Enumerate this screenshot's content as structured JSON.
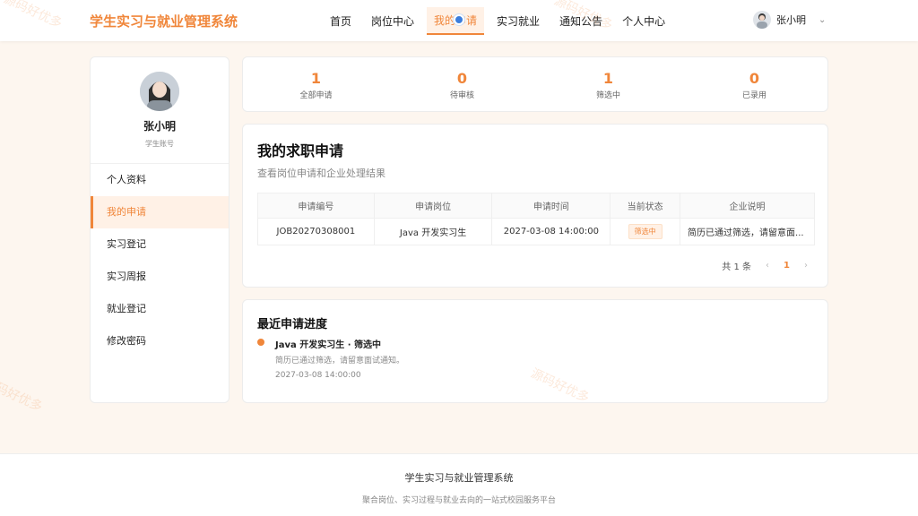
{
  "header": {
    "brand": "学生实习与就业管理系统",
    "nav": [
      {
        "label": "首页"
      },
      {
        "label": "岗位中心"
      },
      {
        "label": "我的申请"
      },
      {
        "label": "实习就业"
      },
      {
        "label": "通知公告"
      },
      {
        "label": "个人中心"
      }
    ],
    "active_nav": "我的申请",
    "user": {
      "name": "张小明"
    }
  },
  "sidebar": {
    "name": "张小明",
    "role": "学生账号",
    "items": [
      {
        "label": "个人资料"
      },
      {
        "label": "我的申请"
      },
      {
        "label": "实习登记"
      },
      {
        "label": "实习周报"
      },
      {
        "label": "就业登记"
      },
      {
        "label": "修改密码"
      }
    ],
    "active": "我的申请"
  },
  "stats": [
    {
      "value": "1",
      "label": "全部申请"
    },
    {
      "value": "0",
      "label": "待审核"
    },
    {
      "value": "1",
      "label": "筛选中"
    },
    {
      "value": "0",
      "label": "已录用"
    }
  ],
  "applications": {
    "title": "我的求职申请",
    "subtitle": "查看岗位申请和企业处理结果",
    "columns": [
      "申请编号",
      "申请岗位",
      "申请时间",
      "当前状态",
      "企业说明"
    ],
    "rows": [
      {
        "id": "JOB20270308001",
        "position": "Java 开发实习生",
        "time": "2027-03-08 14:00:00",
        "status": "筛选中",
        "note": "简历已通过筛选，请留意面..."
      }
    ],
    "total_text": "共 1 条",
    "page": "1",
    "prev": "‹",
    "next": "›"
  },
  "progress": {
    "title": "最近申请进度",
    "items": [
      {
        "title": "Java 开发实习生 · 筛选中",
        "desc": "简历已通过筛选，请留意面试通知。",
        "time": "2027-03-08 14:00:00"
      }
    ]
  },
  "footer": {
    "title": "学生实习与就业管理系统",
    "subtitle": "聚合岗位、实习过程与就业去向的一站式校园服务平台"
  },
  "watermark": "源码好优多",
  "colors": {
    "accent": "#f0863a",
    "accent_bg": "#fff1e6",
    "page_bg": "#fdf6ef"
  }
}
